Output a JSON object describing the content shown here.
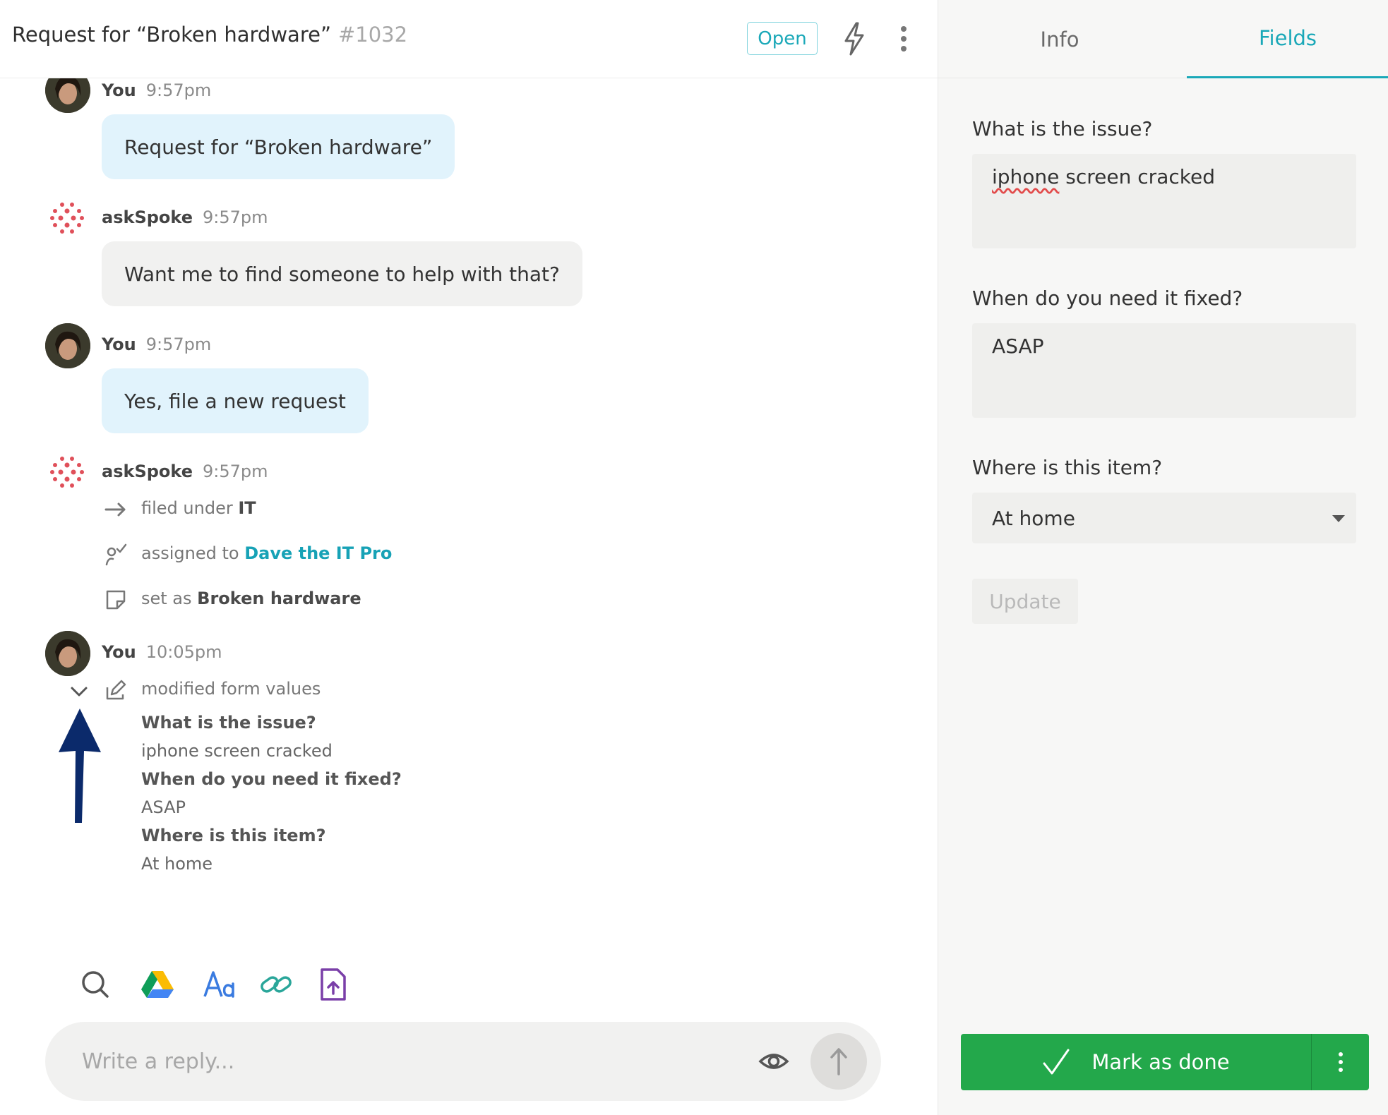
{
  "header": {
    "title": "Request for “Broken hardware”",
    "ticket_number": "#1032",
    "status": "Open"
  },
  "messages": [
    {
      "author": "You",
      "time": "9:57pm",
      "text": "Request for “Broken hardware”"
    },
    {
      "author": "askSpoke",
      "time": "9:57pm",
      "text": "Want me to find someone to help with that?"
    },
    {
      "author": "You",
      "time": "9:57pm",
      "text": "Yes, file a new request"
    },
    {
      "author": "askSpoke",
      "time": "9:57pm"
    },
    {
      "author": "You",
      "time": "10:05pm"
    }
  ],
  "events": {
    "filed_prefix": "filed under",
    "filed_value": "IT",
    "assigned_prefix": "assigned to",
    "assigned_value": "Dave the IT Pro",
    "set_prefix": "set as",
    "set_value": "Broken hardware",
    "modified_label": "modified form values"
  },
  "form_values": [
    {
      "question": "What is the issue?",
      "answer": "iphone screen cracked"
    },
    {
      "question": "When do you need it fixed?",
      "answer": "ASAP"
    },
    {
      "question": "Where is this item?",
      "answer": "At home"
    }
  ],
  "composer": {
    "placeholder": "Write a reply..."
  },
  "toolbar_icons": [
    "search-icon",
    "google-drive-icon",
    "text-format-icon",
    "link-icon",
    "file-upload-icon"
  ],
  "sidebar": {
    "tabs": [
      {
        "label": "Info",
        "active": false
      },
      {
        "label": "Fields",
        "active": true
      }
    ],
    "fields": [
      {
        "label": "What is the issue?",
        "value": "iphone screen cracked"
      },
      {
        "label": "When do you need it fixed?",
        "value": "ASAP"
      },
      {
        "label": "Where is this item?",
        "value": "At home"
      }
    ],
    "update_label": "Update",
    "done_label": "Mark as done"
  },
  "colors": {
    "accent": "#1aa8b8",
    "user_bubble": "#e1f3fc",
    "bot_bubble": "#f1f1f0",
    "done_button": "#23a84b",
    "annotation_arrow": "#0b2a6b",
    "bot_logo": "#e0505a"
  }
}
